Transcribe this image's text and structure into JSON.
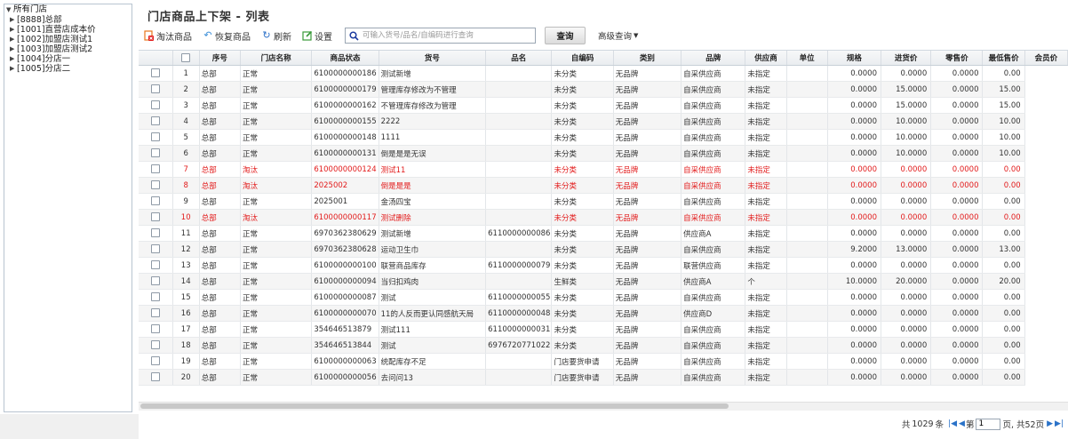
{
  "window_title": "门店商品上下架 - 列表",
  "tree": {
    "root": "所有门店",
    "children": [
      "[8888]总部",
      "[1001]直营店成本价",
      "[1002]加盟店测试1",
      "[1003]加盟店测试2",
      "[1004]分店一",
      "[1005]分店二"
    ]
  },
  "toolbar": {
    "eliminate": "淘汰商品",
    "restore": "恢复商品",
    "refresh": "刷新",
    "settings": "设置",
    "search_placeholder": "可输入货号/品名/自编码进行查询",
    "query": "查询",
    "advanced": "高级查询"
  },
  "table": {
    "columns": [
      "",
      "序号",
      "门店名称",
      "商品状态",
      "货号",
      "品名",
      "自编码",
      "类别",
      "品牌",
      "供应商",
      "单位",
      "规格",
      "进货价",
      "零售价",
      "最低售价",
      "会员价"
    ],
    "rows": [
      {
        "no": "1",
        "store": "总部",
        "status": "正常",
        "sku": "6100000000186",
        "name": "测试新增",
        "code": "",
        "cat": "未分类",
        "brand": "无品牌",
        "supplier": "自采供应商",
        "unit": "未指定",
        "spec": "",
        "buy": "0.0000",
        "retail": "0.0000",
        "min": "0.0000",
        "member": "0.00",
        "red": false
      },
      {
        "no": "2",
        "store": "总部",
        "status": "正常",
        "sku": "6100000000179",
        "name": "管理库存修改为不管理",
        "code": "",
        "cat": "未分类",
        "brand": "无品牌",
        "supplier": "自采供应商",
        "unit": "未指定",
        "spec": "",
        "buy": "0.0000",
        "retail": "15.0000",
        "min": "0.0000",
        "member": "15.00",
        "red": false
      },
      {
        "no": "3",
        "store": "总部",
        "status": "正常",
        "sku": "6100000000162",
        "name": "不管理库存修改为管理",
        "code": "",
        "cat": "未分类",
        "brand": "无品牌",
        "supplier": "自采供应商",
        "unit": "未指定",
        "spec": "",
        "buy": "0.0000",
        "retail": "15.0000",
        "min": "0.0000",
        "member": "15.00",
        "red": false
      },
      {
        "no": "4",
        "store": "总部",
        "status": "正常",
        "sku": "6100000000155",
        "name": "2222",
        "code": "",
        "cat": "未分类",
        "brand": "无品牌",
        "supplier": "自采供应商",
        "unit": "未指定",
        "spec": "",
        "buy": "0.0000",
        "retail": "10.0000",
        "min": "0.0000",
        "member": "10.00",
        "red": false
      },
      {
        "no": "5",
        "store": "总部",
        "status": "正常",
        "sku": "6100000000148",
        "name": "1111",
        "code": "",
        "cat": "未分类",
        "brand": "无品牌",
        "supplier": "自采供应商",
        "unit": "未指定",
        "spec": "",
        "buy": "0.0000",
        "retail": "10.0000",
        "min": "0.0000",
        "member": "10.00",
        "red": false
      },
      {
        "no": "6",
        "store": "总部",
        "status": "正常",
        "sku": "6100000000131",
        "name": "倒是是是无误",
        "code": "",
        "cat": "未分类",
        "brand": "无品牌",
        "supplier": "自采供应商",
        "unit": "未指定",
        "spec": "",
        "buy": "0.0000",
        "retail": "10.0000",
        "min": "0.0000",
        "member": "10.00",
        "red": false
      },
      {
        "no": "7",
        "store": "总部",
        "status": "淘汰",
        "sku": "6100000000124",
        "name": "测试11",
        "code": "",
        "cat": "未分类",
        "brand": "无品牌",
        "supplier": "自采供应商",
        "unit": "未指定",
        "spec": "",
        "buy": "0.0000",
        "retail": "0.0000",
        "min": "0.0000",
        "member": "0.00",
        "red": true
      },
      {
        "no": "8",
        "store": "总部",
        "status": "淘汰",
        "sku": "2025002",
        "name": "倒是是是",
        "code": "",
        "cat": "未分类",
        "brand": "无品牌",
        "supplier": "自采供应商",
        "unit": "未指定",
        "spec": "",
        "buy": "0.0000",
        "retail": "0.0000",
        "min": "0.0000",
        "member": "0.00",
        "red": true
      },
      {
        "no": "9",
        "store": "总部",
        "status": "正常",
        "sku": "2025001",
        "name": "金汤四宝",
        "code": "",
        "cat": "未分类",
        "brand": "无品牌",
        "supplier": "自采供应商",
        "unit": "未指定",
        "spec": "",
        "buy": "0.0000",
        "retail": "0.0000",
        "min": "0.0000",
        "member": "0.00",
        "red": false
      },
      {
        "no": "10",
        "store": "总部",
        "status": "淘汰",
        "sku": "6100000000117",
        "name": "测试删除",
        "code": "",
        "cat": "未分类",
        "brand": "无品牌",
        "supplier": "自采供应商",
        "unit": "未指定",
        "spec": "",
        "buy": "0.0000",
        "retail": "0.0000",
        "min": "0.0000",
        "member": "0.00",
        "red": true
      },
      {
        "no": "11",
        "store": "总部",
        "status": "正常",
        "sku": "6970362380629",
        "name": "测试新增",
        "code": "6110000000086",
        "cat": "未分类",
        "brand": "无品牌",
        "supplier": "供应商A",
        "unit": "未指定",
        "spec": "",
        "buy": "0.0000",
        "retail": "0.0000",
        "min": "0.0000",
        "member": "0.00",
        "red": false
      },
      {
        "no": "12",
        "store": "总部",
        "status": "正常",
        "sku": "6970362380628",
        "name": "运动卫生巾",
        "code": "",
        "cat": "未分类",
        "brand": "无品牌",
        "supplier": "自采供应商",
        "unit": "未指定",
        "spec": "",
        "buy": "9.2000",
        "retail": "13.0000",
        "min": "0.0000",
        "member": "13.00",
        "red": false
      },
      {
        "no": "13",
        "store": "总部",
        "status": "正常",
        "sku": "6100000000100",
        "name": "联营商品库存",
        "code": "6110000000079",
        "cat": "未分类",
        "brand": "无品牌",
        "supplier": "联营供应商",
        "unit": "未指定",
        "spec": "",
        "buy": "0.0000",
        "retail": "0.0000",
        "min": "0.0000",
        "member": "0.00",
        "red": false
      },
      {
        "no": "14",
        "store": "总部",
        "status": "正常",
        "sku": "6100000000094",
        "name": "当归扣鸡肉",
        "code": "",
        "cat": "生鲜类",
        "brand": "无品牌",
        "supplier": "供应商A",
        "unit": "个",
        "spec": "",
        "buy": "10.0000",
        "retail": "20.0000",
        "min": "0.0000",
        "member": "20.00",
        "red": false
      },
      {
        "no": "15",
        "store": "总部",
        "status": "正常",
        "sku": "6100000000087",
        "name": "测试",
        "code": "6110000000055",
        "cat": "未分类",
        "brand": "无品牌",
        "supplier": "自采供应商",
        "unit": "未指定",
        "spec": "",
        "buy": "0.0000",
        "retail": "0.0000",
        "min": "0.0000",
        "member": "0.00",
        "red": false
      },
      {
        "no": "16",
        "store": "总部",
        "status": "正常",
        "sku": "6100000000070",
        "name": "11的人反而更认同感航天局",
        "code": "6110000000048",
        "cat": "未分类",
        "brand": "无品牌",
        "supplier": "供应商D",
        "unit": "未指定",
        "spec": "",
        "buy": "0.0000",
        "retail": "0.0000",
        "min": "0.0000",
        "member": "0.00",
        "red": false
      },
      {
        "no": "17",
        "store": "总部",
        "status": "正常",
        "sku": "354646513879",
        "name": "测试111",
        "code": "6110000000031",
        "cat": "未分类",
        "brand": "无品牌",
        "supplier": "自采供应商",
        "unit": "未指定",
        "spec": "",
        "buy": "0.0000",
        "retail": "0.0000",
        "min": "0.0000",
        "member": "0.00",
        "red": false
      },
      {
        "no": "18",
        "store": "总部",
        "status": "正常",
        "sku": "354646513844",
        "name": "测试",
        "code": "6976720771022",
        "cat": "未分类",
        "brand": "无品牌",
        "supplier": "自采供应商",
        "unit": "未指定",
        "spec": "",
        "buy": "0.0000",
        "retail": "0.0000",
        "min": "0.0000",
        "member": "0.00",
        "red": false
      },
      {
        "no": "19",
        "store": "总部",
        "status": "正常",
        "sku": "6100000000063",
        "name": "统配库存不足",
        "code": "",
        "cat": "门店要货申请",
        "brand": "无品牌",
        "supplier": "自采供应商",
        "unit": "未指定",
        "spec": "",
        "buy": "0.0000",
        "retail": "0.0000",
        "min": "0.0000",
        "member": "0.00",
        "red": false
      },
      {
        "no": "20",
        "store": "总部",
        "status": "正常",
        "sku": "6100000000056",
        "name": "去问问13",
        "code": "",
        "cat": "门店要货申请",
        "brand": "无品牌",
        "supplier": "自采供应商",
        "unit": "未指定",
        "spec": "",
        "buy": "0.0000",
        "retail": "0.0000",
        "min": "0.0000",
        "member": "0.00",
        "red": false
      }
    ]
  },
  "pager": {
    "total_prefix": "共",
    "total": "1029",
    "total_suffix": "条",
    "page_label_before": "第",
    "page": "1",
    "page_label_after": "页, 共52页"
  },
  "colors": {
    "red_row": "#e21b1b",
    "pager_icon": "#2a72c8"
  },
  "icons": {
    "eliminate": "document-x-icon",
    "restore": "restore-arrow-icon",
    "refresh": "refresh-icon",
    "settings": "edit-icon",
    "search": "search-icon",
    "advanced": "caret-down-icon"
  }
}
